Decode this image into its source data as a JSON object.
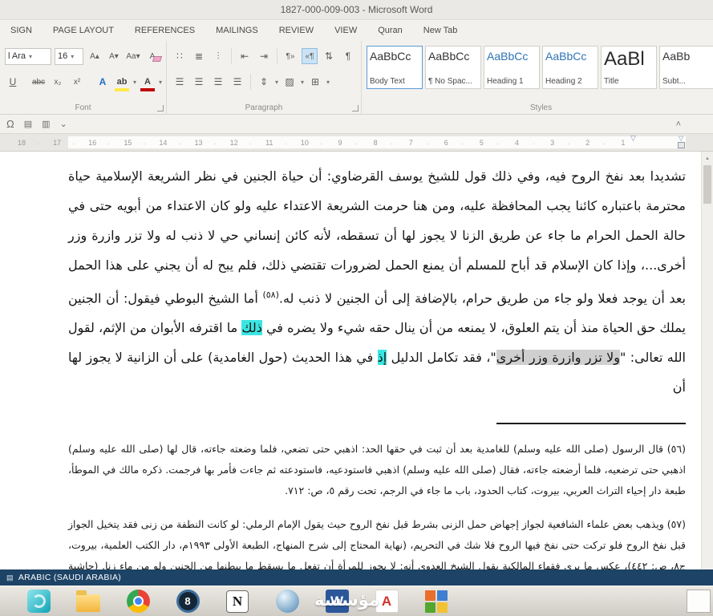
{
  "title_bar": {
    "title": "1827-000-009-003 - Microsoft Word"
  },
  "ribbon_tabs": [
    {
      "label": "SIGN"
    },
    {
      "label": "PAGE LAYOUT"
    },
    {
      "label": "REFERENCES"
    },
    {
      "label": "MAILINGS"
    },
    {
      "label": "REVIEW"
    },
    {
      "label": "VIEW"
    },
    {
      "label": "Quran"
    },
    {
      "label": "New Tab"
    }
  ],
  "font_group": {
    "label": "Font",
    "font_name_value": "l Ara",
    "font_size_value": "16",
    "grow_font": "A▴",
    "shrink_font": "A▾",
    "change_case": "Aa▾",
    "clear_formatting": "A",
    "underline": "U",
    "strikethrough": "abc",
    "subscript": "x₂",
    "superscript": "x²",
    "text_effects": "A",
    "highlight_letters": "ab",
    "font_color_letter": "A"
  },
  "paragraph_group": {
    "label": "Paragraph",
    "bullets": "∷",
    "numbering": "≣",
    "multilevel": "⫶",
    "outdent": "⇤",
    "indent": "⇥",
    "ltr_direction": "¶»",
    "rtl_direction": "«¶",
    "sort": "⇅",
    "pilcrow": "¶",
    "align_left": "☰",
    "align_center": "☰",
    "align_right": "☰",
    "justify": "☰",
    "line_spacing": "⇕",
    "shading": "▨",
    "borders": "⊞"
  },
  "styles_group": {
    "label": "Styles",
    "items": [
      {
        "preview": "AaBbCc",
        "name": "Body Text"
      },
      {
        "preview": "AaBbCc",
        "name": "¶ No Spac..."
      },
      {
        "preview": "AaBbCc",
        "name": "Heading 1"
      },
      {
        "preview": "AaBbCc",
        "name": "Heading 2"
      },
      {
        "preview": "AaBl",
        "name": "Title"
      },
      {
        "preview": "AaBb",
        "name": "Subt..."
      }
    ]
  },
  "addin_row": {
    "omega": "Ω",
    "list_icon": "▤",
    "columns_icon": "▥",
    "dropdown": "⌄",
    "collapse": "˄"
  },
  "ruler": {
    "numbers": [
      "18",
      "17",
      "16",
      "15",
      "14",
      "13",
      "12",
      "11",
      "10",
      "9",
      "8",
      "7",
      "6",
      "5",
      "4",
      "3",
      "2",
      "1"
    ],
    "first_line_marker": "▽",
    "hanging_marker": "▽"
  },
  "document": {
    "body_segments": [
      {
        "style": "normal",
        "text": "تشديدا بعد نفخ الروح فيه، وفي ذلك قول للشيخ يوسف القرضاوي: أن حياة الجنين في نظر الشريعة الإسلامية حياة محترمة باعتباره كائنا يجب المحافظة عليه، ومن هنا حرمت الشريعة الاعتداء عليه ولو كان الاعتداء من أبويه حتى في حالة الحمل الحرام ما جاء عن طريق الزنا لا يجوز لها أن تسقطه، لأنه كائن إنساني حي لا ذنب له ولا تزر وازرة وزر أخرى...، وإذا كان الإسلام قد أباح للمسلم أن يمنع الحمل لضرورات تقتضي ذلك، فلم يبح له أن يجني على هذا الحمل بعد أن يوجد فعلا ولو جاء من طريق حرام، بالإضافة إلى أن الجنين لا ذنب له."
      },
      {
        "style": "sup",
        "text": "(٥٨)"
      },
      {
        "style": "normal",
        "text": " أما الشيخ البوطي فيقول: أن الجنين يملك حق الحياة منذ أن يتم العلوق، لا يمنعه من أن ينال حقه شيء ولا يضره في "
      },
      {
        "style": "cyan",
        "text": "ذلك"
      },
      {
        "style": "normal",
        "text": " ما اقترفه الأبوان من الإثم، لقول الله تعالى: \""
      },
      {
        "style": "selection",
        "text": "ولا تزر وازرة وزر أخرى"
      },
      {
        "style": "normal",
        "text": "\"، فقد تكامل الدليل "
      },
      {
        "style": "cyan",
        "text": "إذ"
      },
      {
        "style": "normal",
        "text": " في هذا الحديث (حول الغامدية) على أن الزانية لا يجوز لها أن"
      }
    ],
    "footnotes": [
      {
        "text": "(٥٦) قال الرسول (صلى الله عليه وسلم) للغامدية بعد أن ثبت في حقها الحد: اذهبي حتى تضعي، فلما وضعته جاءته، قال لها (صلى الله عليه وسلم) اذهبي حتى ترضعيه، فلما أرضعته جاءته، فقال (صلى الله عليه وسلم) اذهبي فاستودعيه، فاستودعته ثم جاءت فأمر بها فرجمت. ذكره مالك في الموطأ، طبعة دار إحياء التراث العربي، بيروت، كتاب الحدود، باب ما جاء في الرجم، تحت رقم ٥، ص: ٧١٢."
      },
      {
        "text": "(٥٧) ويذهب بعض علماء الشافعية لجواز إجهاض حمل الزنى بشرط قبل نفخ الروح حيث يقول الإمام الرملي: لو كانت النطفة من زنى فقد يتخيل الجواز قبل نفخ الروح فلو تركت حتى نفخ فيها الروح فلا شك في التحريم، (نهاية المحتاج إلى شرح المنهاج، الطبعة الأولى ١٩٩٣م، دار الكتب العلمية، بيروت، ج٨، ص: ٤٤٢)، عكس ما يرى فقهاء المالكية بقول الشيخ العدوي أنه: لا يجوز للمرأة أن تفعل ما يسقط ما ببطنها من الجنين ولو من ماء زنا. (حاشية الشيخ على"
      }
    ]
  },
  "status_bar": {
    "language": "ARABIC (SAUDI ARABIA)",
    "icon": "▤"
  },
  "scrollbar": {
    "up_arrow": "▴"
  },
  "taskbar": {
    "watermark": "مؤسسة",
    "icons": [
      {
        "name": "graphics-app-icon",
        "glyph": ""
      },
      {
        "name": "file-explorer-icon",
        "glyph": ""
      },
      {
        "name": "chrome-icon",
        "glyph": ""
      },
      {
        "name": "ring-app-icon",
        "glyph": "8"
      },
      {
        "name": "notion-app-icon",
        "glyph": "N"
      },
      {
        "name": "blue-orb-app-icon",
        "glyph": ""
      },
      {
        "name": "word-icon",
        "glyph": "W"
      },
      {
        "name": "acrobat-icon",
        "glyph": "A"
      },
      {
        "name": "grid-app-icon",
        "glyph": ""
      }
    ]
  },
  "colors": {
    "highlight_cyan": "#3ae6e2",
    "selection_gray": "#cfcfcf",
    "heading_blue": "#2e74b5",
    "status_bar_blue": "#1d4366",
    "word_blue": "#2b579a"
  }
}
